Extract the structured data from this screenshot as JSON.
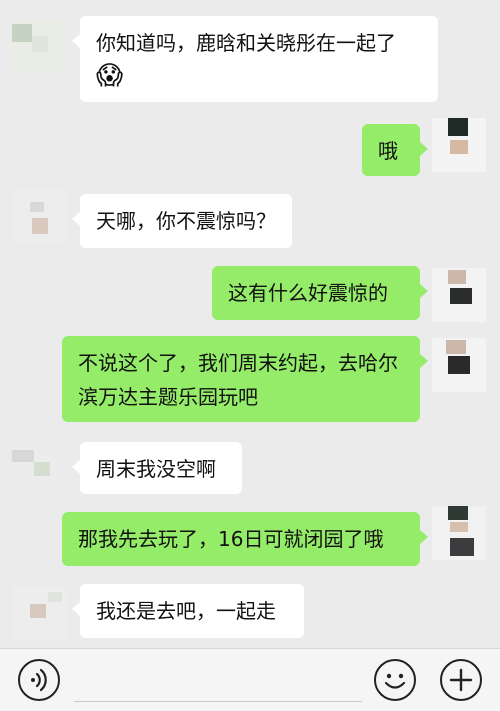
{
  "messages": [
    {
      "side": "in",
      "text": "你知道吗，鹿晗和关晓彤在一起了",
      "emoji": "😱"
    },
    {
      "side": "out",
      "text": "哦"
    },
    {
      "side": "in",
      "text": "天哪，你不震惊吗？"
    },
    {
      "side": "out",
      "text": "这有什么好震惊的"
    },
    {
      "side": "out",
      "line1": "不说这个了，我们周末约起，去哈尔",
      "line2": "滨万达主题乐园玩吧"
    },
    {
      "side": "in",
      "text": "周末我没空啊"
    },
    {
      "side": "out",
      "text": "那我先去玩了，16日可就闭园了哦"
    },
    {
      "side": "in",
      "text": "我还是去吧，一起走"
    }
  ],
  "input_bar": {
    "voice_icon": "voice-icon",
    "emoji_icon": "smiley-icon",
    "add_icon": "plus-icon"
  },
  "colors": {
    "incoming_bubble": "#ffffff",
    "outgoing_bubble": "#95ec69",
    "background": "#ebebeb"
  }
}
